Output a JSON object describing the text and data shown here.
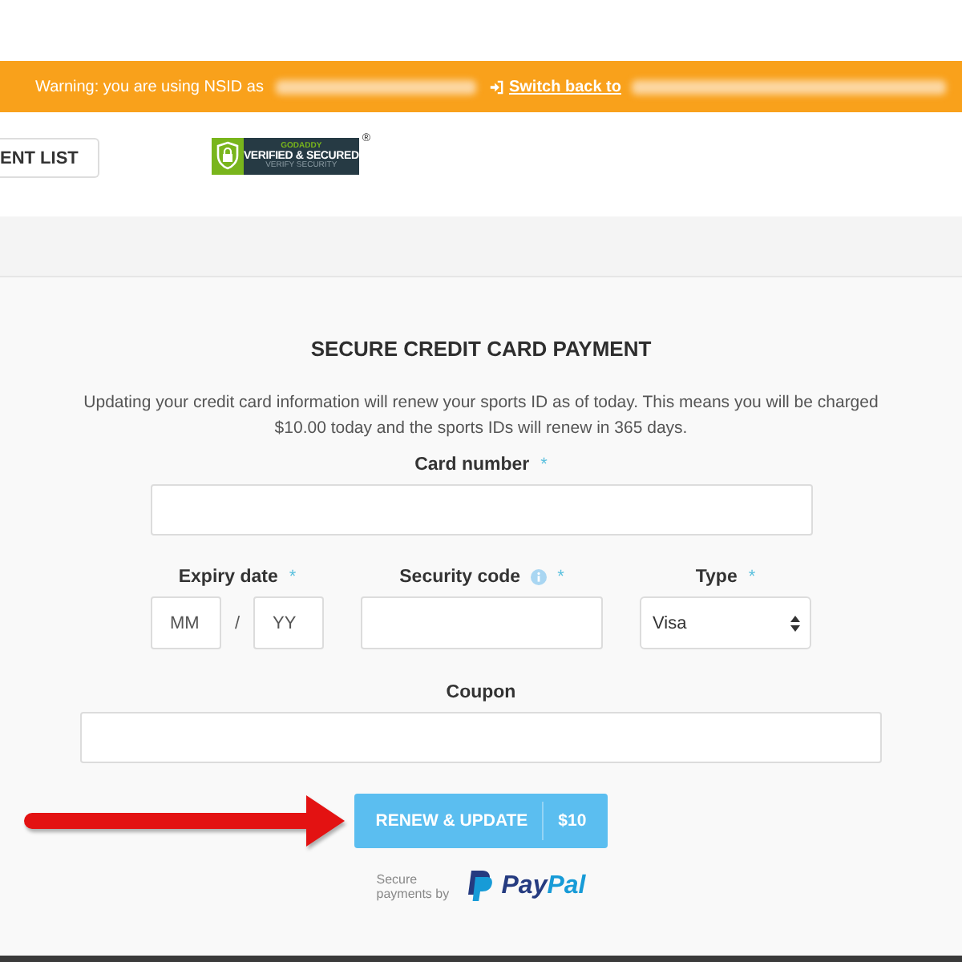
{
  "banner": {
    "warning": "Warning: you are using NSID as",
    "switch_link": "Switch back to"
  },
  "header": {
    "nav_button": "ENT LIST",
    "badge": {
      "brand": "GODADDY",
      "title": "VERIFIED & SECURED",
      "subtitle": "VERIFY SECURITY",
      "registered_mark": "®"
    }
  },
  "payment_form": {
    "title": "SECURE CREDIT CARD PAYMENT",
    "description": "Updating your credit card information will renew your sports ID as of today. This means you will be charged $10.00 today and the sports IDs will renew in 365 days.",
    "rows": [
      [
        {
          "kind": "text",
          "label": "Card number",
          "required_mark": "*",
          "info": false
        }
      ],
      [
        {
          "kind": "expiry",
          "label": "Expiry date",
          "required_mark": "*",
          "info": false,
          "month_placeholder": "MM",
          "separator": "/",
          "year_placeholder": "YY"
        },
        {
          "kind": "text",
          "label": "Security code",
          "required_mark": "*",
          "info": true
        },
        {
          "kind": "select",
          "label": "Type",
          "required_mark": "*",
          "info": false,
          "value": "Visa"
        }
      ],
      [
        {
          "kind": "text",
          "label": "Coupon",
          "info": false
        }
      ]
    ],
    "submit_button": {
      "label": "RENEW & UPDATE",
      "price": "$10"
    },
    "footer": {
      "text": "Secure payments by",
      "brand": [
        "Pay",
        "Pal"
      ]
    }
  }
}
